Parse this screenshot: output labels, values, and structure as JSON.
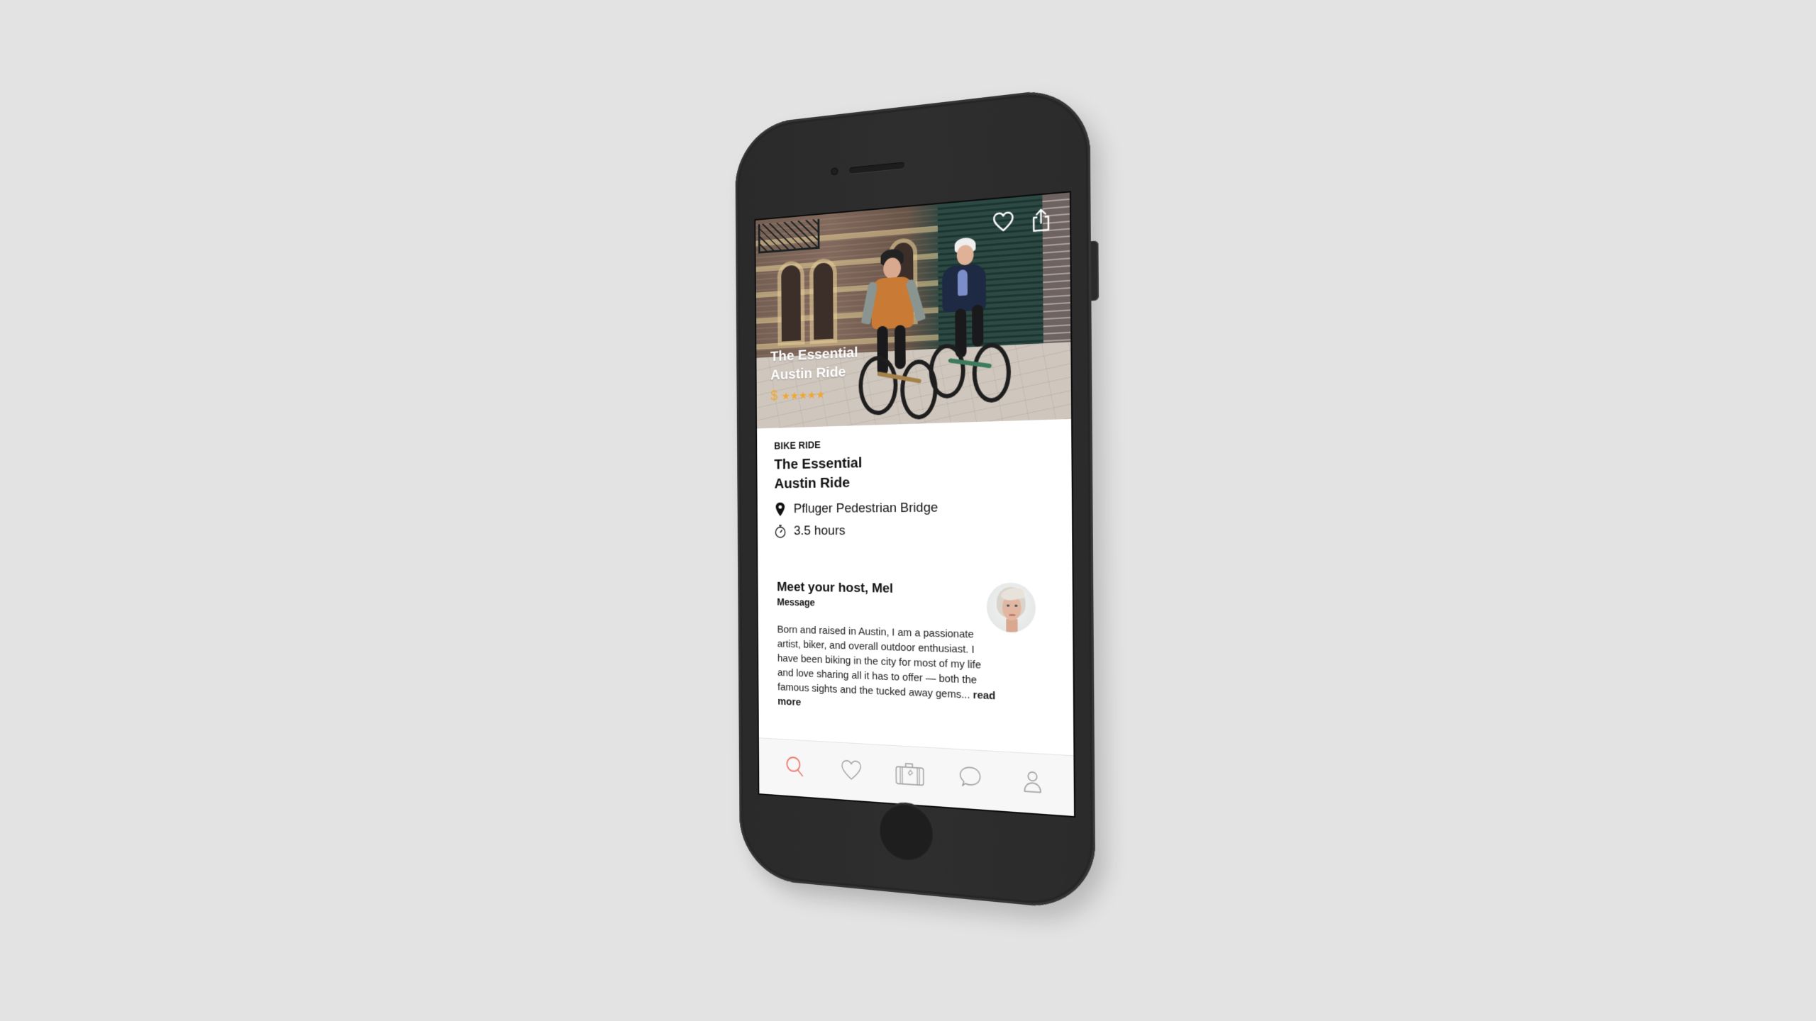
{
  "colors": {
    "background": "#e3e3e3",
    "phone_body": "#2b2b2b",
    "accent": "#e8796a",
    "rating": "#f2a630",
    "tab_inactive": "#9a9a9a",
    "text": "#111111"
  },
  "hero": {
    "title_line1": "The Essential",
    "title_line2": "Austin Ride",
    "price": "$",
    "stars": "★★★★★",
    "rating_value": 5,
    "rating_max": 5,
    "actions": [
      {
        "name": "favorite",
        "icon": "heart-icon"
      },
      {
        "name": "share",
        "icon": "share-icon"
      }
    ]
  },
  "experience": {
    "category": "BIKE RIDE",
    "title_line1": "The Essential",
    "title_line2": "Austin Ride",
    "location": "Pfluger Pedestrian Bridge",
    "location_icon": "map-pin-icon",
    "duration": "3.5 hours",
    "duration_icon": "stopwatch-icon"
  },
  "host": {
    "heading": "Meet your host, Mel",
    "message_link": "Message",
    "bio": "Born and raised in Austin, I am a passionate artist, biker, and overall outdoor enthusiast. I have been biking in the city for most of my life and love sharing all it has to offer — both the famous sights and the tucked away gems...",
    "read_more": "read more"
  },
  "tabbar": {
    "active_index": 0,
    "items": [
      {
        "name": "search",
        "icon": "search-icon"
      },
      {
        "name": "favorites",
        "icon": "heart-icon"
      },
      {
        "name": "trips",
        "icon": "suitcase-icon"
      },
      {
        "name": "messages",
        "icon": "chat-bubble-icon"
      },
      {
        "name": "profile",
        "icon": "user-icon"
      }
    ]
  }
}
